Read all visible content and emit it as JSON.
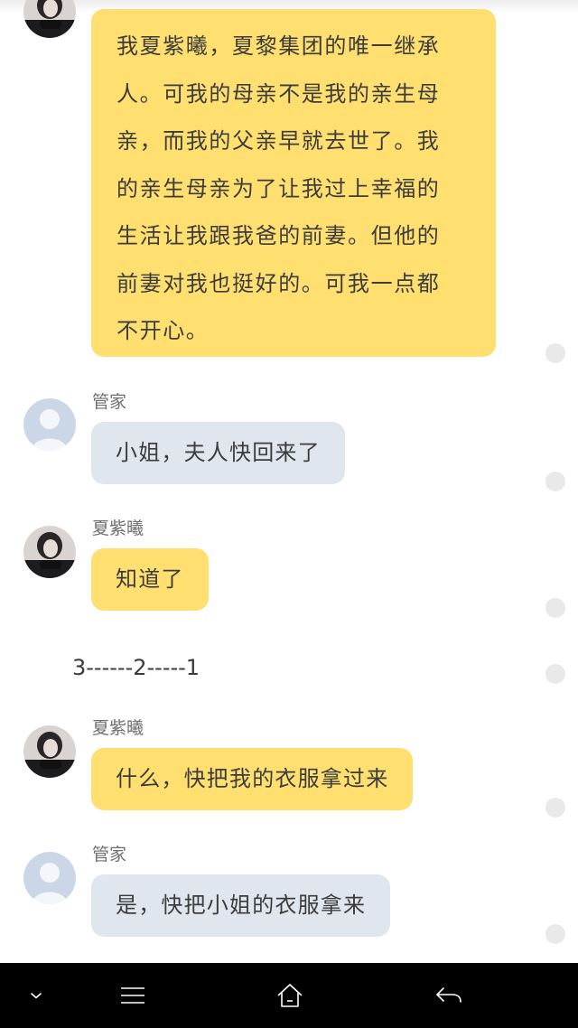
{
  "messages": [
    {
      "sender": "heroine",
      "lines": [
        "我夏紫曦，夏黎集团的唯一继承",
        "人。可我的母亲不是我的亲生母",
        "亲，而我的父亲早就去世了。我",
        "的亲生母亲为了让我过上幸福的",
        "生活让我跟我爸的前妻。但他的",
        "前妻对我也挺好的。可我一点都",
        "不开心。"
      ]
    },
    {
      "sender": "butler",
      "name": "管家",
      "text": "小姐，夫人快回来了"
    },
    {
      "sender": "heroine",
      "name": "夏紫曦",
      "text": "知道了"
    },
    {
      "sender": "narration",
      "text": "3------2-----1"
    },
    {
      "sender": "heroine",
      "name": "夏紫曦",
      "text": "什么，快把我的衣服拿过来"
    },
    {
      "sender": "butler",
      "name": "管家",
      "text": "是，快把小姐的衣服拿来"
    }
  ],
  "navbar": {
    "icons": [
      "chevron-down-icon",
      "menu-icon",
      "home-icon",
      "back-icon"
    ],
    "background": "#000000"
  },
  "colors": {
    "heroine_bubble": "#fedf70",
    "butler_bubble": "#dfe6ee",
    "avatar_placeholder": "#cbd7e6",
    "dot": "#e9e9e9"
  }
}
